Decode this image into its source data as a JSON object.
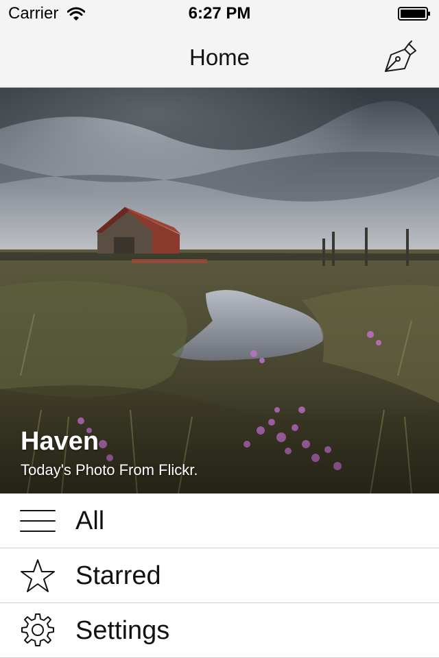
{
  "status_bar": {
    "carrier": "Carrier",
    "time": "6:27 PM",
    "wifi_icon": "wifi-icon",
    "battery_icon": "battery-icon"
  },
  "nav": {
    "title": "Home",
    "compose_icon": "pen-nib-icon"
  },
  "hero": {
    "title": "Haven",
    "subtitle": "Today's Photo From Flickr."
  },
  "menu": {
    "items": [
      {
        "label": "All",
        "icon": "hamburger-icon"
      },
      {
        "label": "Starred",
        "icon": "star-icon"
      },
      {
        "label": "Settings",
        "icon": "gear-icon"
      }
    ]
  },
  "colors": {
    "bar_background": "#f4f4f4",
    "separator": "#d0d0d0",
    "text": "#111111"
  }
}
